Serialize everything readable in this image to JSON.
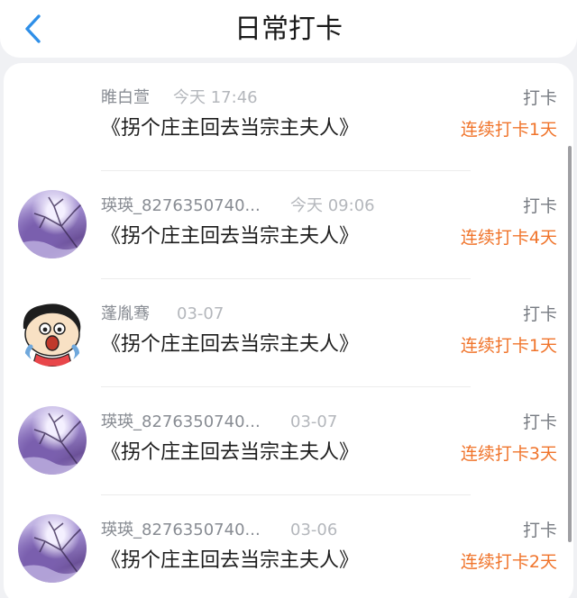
{
  "header": {
    "title": "日常打卡",
    "back_icon": "chevron-left-icon",
    "accent_color": "#2f8fe8"
  },
  "records": [
    {
      "user": "睢白萱",
      "time": "今天 17:46",
      "book": "《拐个庄主回去当宗主夫人》",
      "action": "打卡",
      "streak": "连续打卡1天",
      "avatar": "none"
    },
    {
      "user": "瑛瑛_8276350740...",
      "time": "今天 09:06",
      "book": "《拐个庄主回去当宗主夫人》",
      "action": "打卡",
      "streak": "连续打卡4天",
      "avatar": "winter-tree-avatar"
    },
    {
      "user": "蓬胤骞",
      "time": "03-07",
      "book": "《拐个庄主回去当宗主夫人》",
      "action": "打卡",
      "streak": "连续打卡1天",
      "avatar": "cartoon-boy-avatar"
    },
    {
      "user": "瑛瑛_8276350740...",
      "time": "03-07",
      "book": "《拐个庄主回去当宗主夫人》",
      "action": "打卡",
      "streak": "连续打卡3天",
      "avatar": "winter-tree-avatar"
    },
    {
      "user": "瑛瑛_8276350740...",
      "time": "03-06",
      "book": "《拐个庄主回去当宗主夫人》",
      "action": "打卡",
      "streak": "连续打卡2天",
      "avatar": "winter-tree-avatar"
    }
  ],
  "colors": {
    "streak": "#f0742b",
    "name": "#888c93",
    "time": "#b4b7bc"
  }
}
